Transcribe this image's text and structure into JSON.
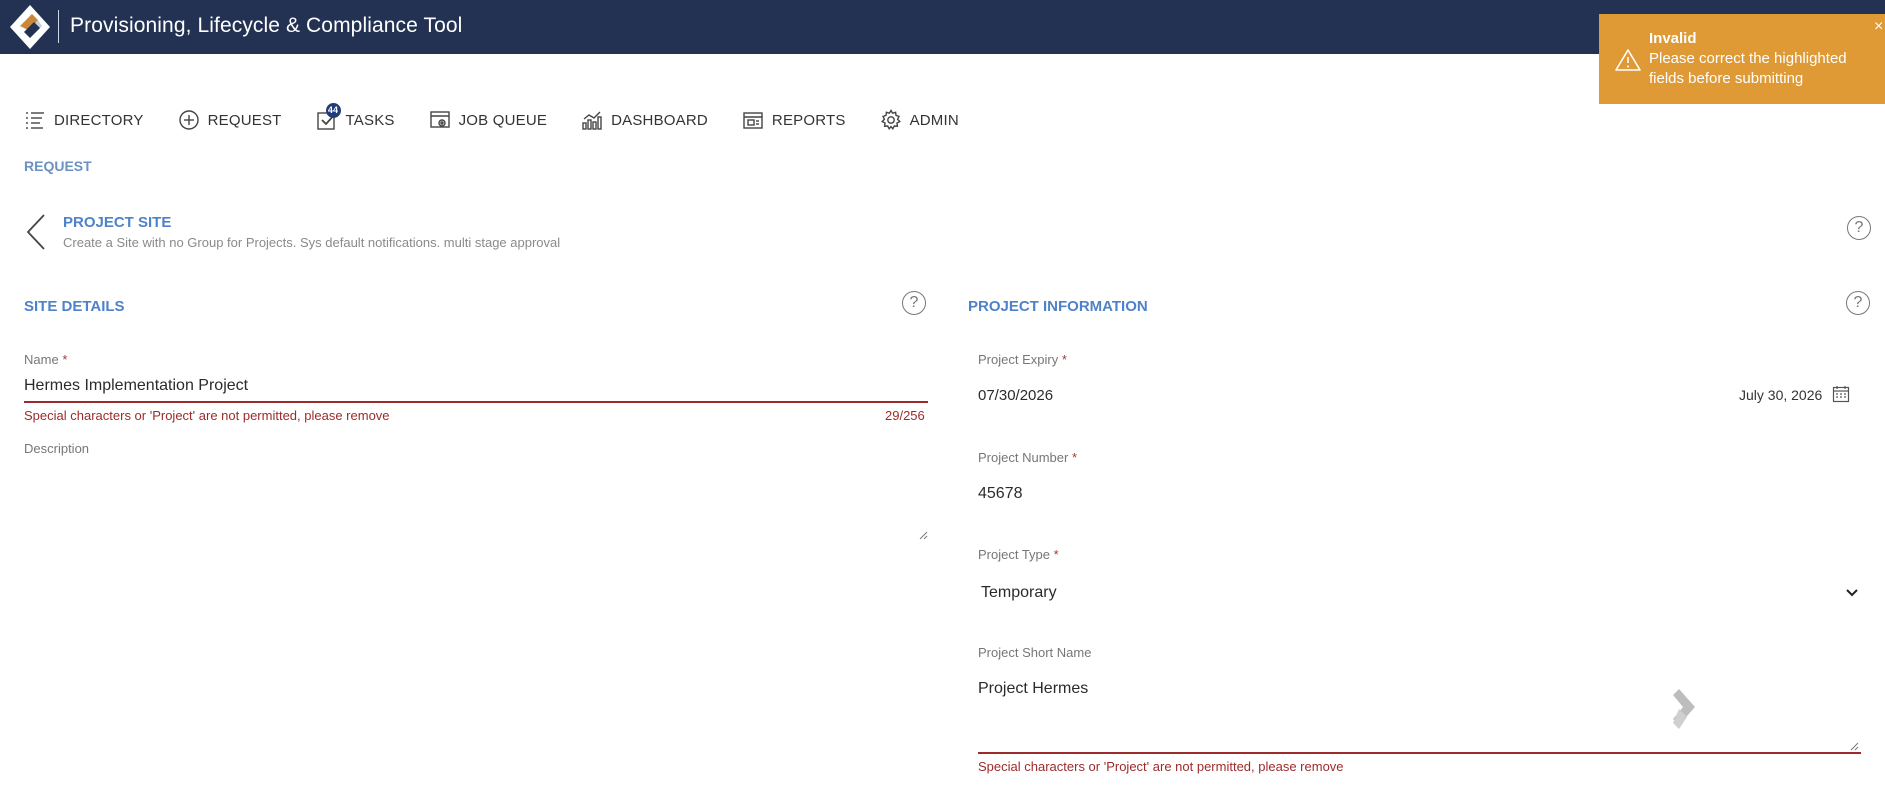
{
  "app": {
    "title": "Provisioning, Lifecycle & Compliance Tool"
  },
  "toast": {
    "title": "Invalid",
    "message": "Please correct the highlighted fields before submitting",
    "close": "×",
    "color": "#df9935"
  },
  "nav": {
    "items": [
      {
        "label": "DIRECTORY",
        "icon": "list-icon"
      },
      {
        "label": "REQUEST",
        "icon": "plus-circle-icon"
      },
      {
        "label": "TASKS",
        "icon": "checkbox-icon",
        "badge": "44"
      },
      {
        "label": "JOB QUEUE",
        "icon": "window-gear-icon"
      },
      {
        "label": "DASHBOARD",
        "icon": "chart-icon"
      },
      {
        "label": "REPORTS",
        "icon": "report-icon"
      },
      {
        "label": "ADMIN",
        "icon": "gear-icon"
      }
    ]
  },
  "breadcrumb": "REQUEST",
  "project_site": {
    "title": "PROJECT SITE",
    "subtitle": "Create a Site with no Group for Projects. Sys default notifications. multi stage approval"
  },
  "site_details": {
    "title": "SITE DETAILS",
    "name_label": "Name",
    "name_value": "Hermes Implementation Project",
    "name_error": "Special characters or 'Project' are not permitted, please remove",
    "name_counter": "29/256",
    "description_label": "Description",
    "description_value": ""
  },
  "project_info": {
    "title": "PROJECT INFORMATION",
    "expiry_label": "Project Expiry",
    "expiry_value": "07/30/2026",
    "expiry_display": "July 30, 2026",
    "number_label": "Project Number",
    "number_value": "45678",
    "type_label": "Project Type",
    "type_value": "Temporary",
    "short_name_label": "Project Short Name",
    "short_name_value": "Project Hermes",
    "short_name_error": "Special characters or 'Project' are not permitted, please remove"
  },
  "required_marker": "*",
  "help_glyph": "?",
  "colors": {
    "header": "#233253",
    "accent": "#4e82c9",
    "error": "#9d2b2b"
  }
}
